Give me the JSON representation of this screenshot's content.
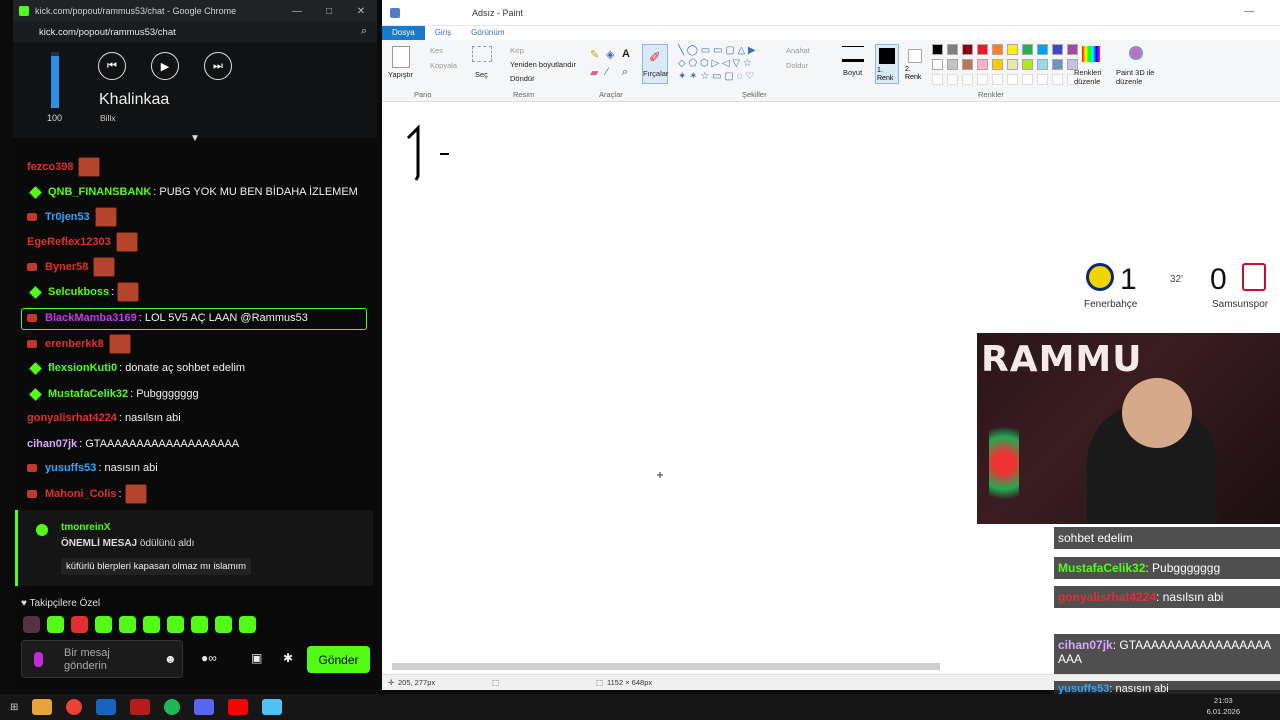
{
  "chrome": {
    "title": "kick.com/popout/rammus53/chat - Google Chrome",
    "url": "kick.com/popout/rammus53/chat",
    "window_controls": [
      "—",
      "□",
      "✕"
    ]
  },
  "media": {
    "volume": 100,
    "volume_label": "100",
    "title": "Khalinkaa",
    "artist": "Billx",
    "prev_icon": "⏮",
    "play_icon": "▶",
    "next_icon": "⏭"
  },
  "chat": {
    "messages": [
      {
        "user": "fezco398",
        "text": "",
        "user_color": "#e03030"
      },
      {
        "user": "QNB_FINANSBANK",
        "text": ": PUBG YOK MU BEN BİDAHA İZLEMEM",
        "user_color": "#53fc18"
      },
      {
        "user": "Tr0jen53",
        "text": "",
        "user_color": "#2fa5ff"
      },
      {
        "user": "EgeReflex12303",
        "text": "",
        "user_color": "#e03030"
      },
      {
        "user": "Byner58",
        "text": "",
        "user_color": "#e03030"
      },
      {
        "user": "Selcukboss",
        "text": ":",
        "user_color": "#53fc18"
      },
      {
        "user": "BlackMamba3169",
        "text": ": LOL 5V5 AÇ LAAN @Rammus53",
        "user_color": "#c13be8"
      },
      {
        "user": "erenberkk8",
        "text": "",
        "user_color": "#e03030"
      },
      {
        "user": "flexsionKuti0",
        "text": ": donate aç sohbet edelim",
        "user_color": "#53fc18"
      },
      {
        "user": "MustafaCelik32",
        "text": ": Pubggggggg",
        "user_color": "#53fc18"
      },
      {
        "user": "gonyalisrhat4224",
        "text": ": nasılsın abi",
        "user_color": "#e03030"
      },
      {
        "user": "cihan07jk",
        "text": ": GTAAAAAAAAAAAAAAAAAAA",
        "user_color": "#d8a6ff"
      },
      {
        "user": "yusuffs53",
        "text": ": nasısın abi",
        "user_color": "#2fa5ff"
      },
      {
        "user": "Mahoni_Colis",
        "text": ":",
        "user_color": "#e03030"
      }
    ],
    "pinned": {
      "user": "tmonreinX",
      "reward_bold": "ÖNEMLİ MESAJ",
      "reward_rest": " ödülünü aldı",
      "text": "küfürlü blerpleri kapasan olmaz mı islamım"
    },
    "followers_label": "Takipçilere Özel",
    "input_placeholder": "Bir mesaj gönderin",
    "send_label": "Gönder"
  },
  "paint": {
    "title": "Adsız - Paint",
    "tabs": [
      "Dosya",
      "Giriş",
      "Görünüm"
    ],
    "groups": {
      "pano": "Pano",
      "resim": "Resim",
      "araclar": "Araçlar",
      "sekiller": "Şekiller",
      "renkler": "Renkler"
    },
    "buttons": {
      "yapistir": "Yapıştır",
      "kes": "Kes",
      "kopyala": "Kopyala",
      "sec": "Seç",
      "kirp": "Kırp",
      "yeniden_boyutlandir": "Yeniden boyutlandır",
      "dondur": "Döndür",
      "fircalar": "Fırçalar",
      "anahat": "Anahat",
      "doldur": "Doldur",
      "boyut": "Boyut",
      "renk1": "1. Renk",
      "renk2": "2. Renk",
      "renkleri_duzenle": "Renkleri düzenle",
      "paint3d": "Paint 3D ile düzenle"
    },
    "palette": [
      "#000000",
      "#7f7f7f",
      "#880015",
      "#ed1c24",
      "#ff7f27",
      "#fff200",
      "#22b14c",
      "#00a2e8",
      "#3f48cc",
      "#a349a4",
      "#ffffff",
      "#c3c3c3",
      "#b97a57",
      "#ffaec9",
      "#ffc90e",
      "#efe4b0",
      "#b5e61d",
      "#99d9ea",
      "#7092be",
      "#c8bfe7"
    ],
    "status": {
      "cursor": "205, 277px",
      "size": "1152 × 648px"
    }
  },
  "scoreboard": {
    "home_team": "Fenerbahçe",
    "home_score": "1",
    "away_team": "Samsunspor",
    "away_score": "0",
    "minute": "32'"
  },
  "webcam": {
    "logo_text": "RAMMU"
  },
  "overlay_chat": [
    {
      "user": "",
      "text": "sohbet edelim"
    },
    {
      "user": "MustafaCelik32",
      "text": ": Pubggggggg",
      "color": "#53fc18"
    },
    {
      "user": "gonyalisrhat4224",
      "text": ": nasılsın abi",
      "color": "#e03030"
    },
    {
      "user": "cihan07jk",
      "text": ": GTAAAAAAAAAAAAAAAAAAAA",
      "color": "#d8a6ff"
    },
    {
      "user": "yusuffs53",
      "text": ": nasısın abi",
      "color": "#2fa5ff"
    }
  ],
  "taskbar": {
    "time": "21:03",
    "date": "6.01.2026"
  }
}
